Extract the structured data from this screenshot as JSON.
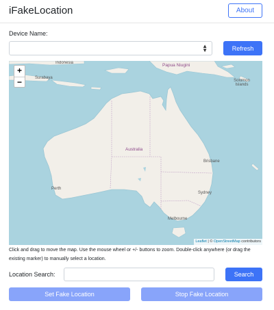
{
  "header": {
    "title": "iFakeLocation",
    "about_label": "About"
  },
  "device": {
    "label": "Device Name:",
    "selected": "",
    "refresh_label": "Refresh"
  },
  "map": {
    "labels": {
      "indonesia": "Indonesia",
      "surabaya": "Surabaya",
      "papua": "Papua Niugini",
      "solomon": "Solomon Islands",
      "australia": "Australia",
      "brisbane": "Brisbane",
      "perth": "Perth",
      "sydney": "Sydney",
      "melbourne": "Melbourne"
    },
    "zoom_in": "+",
    "zoom_out": "−",
    "attribution": {
      "leaflet": "Leaflet",
      "separator": " | © ",
      "osm": "OpenStreetMap",
      "suffix": " contributors"
    },
    "colors": {
      "water": "#aad3df",
      "land": "#f2efe9",
      "border": "#c3a5c8"
    }
  },
  "help_text": "Click and drag to move the map. Use the mouse wheel or +/- buttons to zoom. Double-click anywhere (or drag the existing marker) to manually select a location.",
  "search": {
    "label": "Location Search:",
    "value": "",
    "placeholder": "",
    "button_label": "Search"
  },
  "actions": {
    "set_label": "Set Fake Location",
    "stop_label": "Stop Fake Location"
  },
  "colors": {
    "primary": "#3d73f7",
    "primary_disabled": "#88a4fa"
  }
}
